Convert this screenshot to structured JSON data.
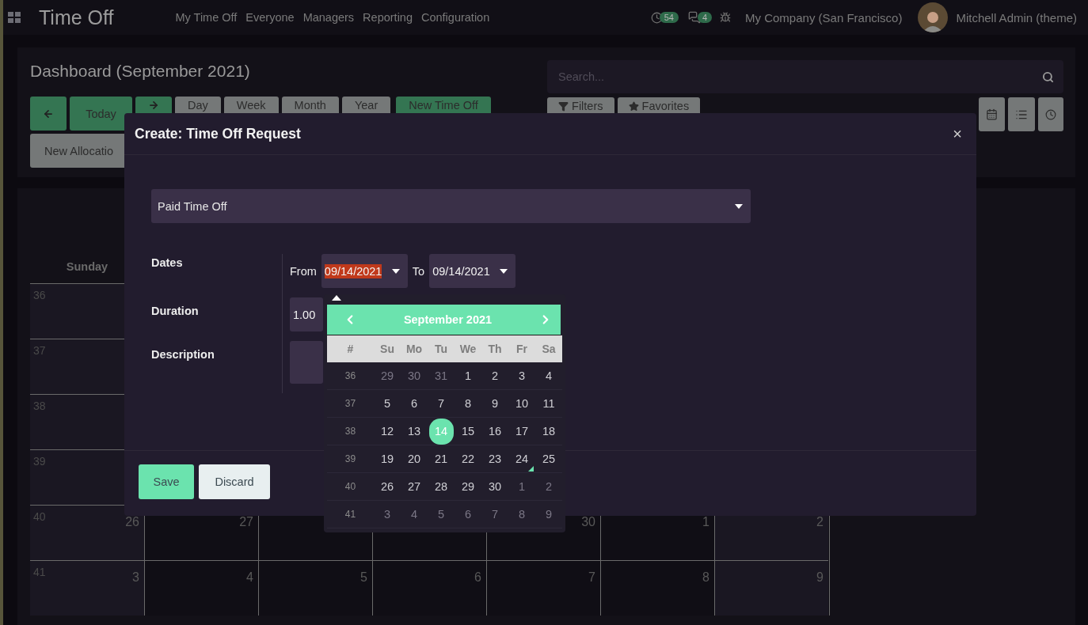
{
  "navbar": {
    "app_title": "Time Off",
    "menu": [
      "My Time Off",
      "Everyone",
      "Managers",
      "Reporting",
      "Configuration"
    ],
    "activity_count": "54",
    "message_count": "4",
    "company": "My Company (San Francisco)",
    "user": "Mitchell Admin (theme)"
  },
  "control_panel": {
    "title": "Dashboard (September 2021)",
    "today_label": "Today",
    "scales": [
      "Day",
      "Week",
      "Month",
      "Year"
    ],
    "new_button": "New Time Off",
    "allocation_button": "New Allocatio",
    "search": {
      "placeholder": "Search..."
    },
    "filters": [
      "Filters",
      "Favorites"
    ]
  },
  "calendar": {
    "columns": [
      "Sunday"
    ],
    "weeks": [
      {
        "number": "36"
      },
      {
        "number": "37"
      },
      {
        "number": "38"
      },
      {
        "number": "39"
      },
      {
        "number": "40",
        "days": {
          "sun": "26",
          "mon": "27",
          "thu": "30",
          "fri": "1",
          "sat": "2"
        }
      },
      {
        "number": "41",
        "days": {
          "sun": "3",
          "mon": "4",
          "tue": "5",
          "wed": "6",
          "thu": "7",
          "fri": "8",
          "sat": "9"
        }
      }
    ]
  },
  "dialog": {
    "title": "Create: Time Off Request",
    "close": "×",
    "leave_type": "Paid Time Off",
    "labels": [
      "Dates",
      "Duration",
      "Description"
    ],
    "from_label": "From",
    "from_date": {
      "value": "09/14/2021",
      "highlighted": true
    },
    "to_label": "To",
    "to_date": {
      "value": "09/14/2021",
      "highlighted": false
    },
    "duration": "1.00",
    "buttons": [
      {
        "label": "Save",
        "kind": "primary"
      },
      {
        "label": "Discard",
        "kind": "secondary"
      }
    ]
  },
  "datepicker": {
    "title": "September 2021",
    "week_header": "#",
    "weekdays": [
      "Su",
      "Mo",
      "Tu",
      "We",
      "Th",
      "Fr",
      "Sa"
    ],
    "weeks": [
      {
        "number": "36",
        "days": [
          {
            "label": "29",
            "muted": true,
            "selected": false,
            "today": false
          },
          {
            "label": "30",
            "muted": true,
            "selected": false,
            "today": false
          },
          {
            "label": "31",
            "muted": true,
            "selected": false,
            "today": false
          },
          {
            "label": "1",
            "muted": false,
            "selected": false,
            "today": false
          },
          {
            "label": "2",
            "muted": false,
            "selected": false,
            "today": false
          },
          {
            "label": "3",
            "muted": false,
            "selected": false,
            "today": false
          },
          {
            "label": "4",
            "muted": false,
            "selected": false,
            "today": false
          }
        ]
      },
      {
        "number": "37",
        "days": [
          {
            "label": "5",
            "muted": false,
            "selected": false,
            "today": false
          },
          {
            "label": "6",
            "muted": false,
            "selected": false,
            "today": false
          },
          {
            "label": "7",
            "muted": false,
            "selected": false,
            "today": false
          },
          {
            "label": "8",
            "muted": false,
            "selected": false,
            "today": false
          },
          {
            "label": "9",
            "muted": false,
            "selected": false,
            "today": false
          },
          {
            "label": "10",
            "muted": false,
            "selected": false,
            "today": false
          },
          {
            "label": "11",
            "muted": false,
            "selected": false,
            "today": false
          }
        ]
      },
      {
        "number": "38",
        "days": [
          {
            "label": "12",
            "muted": false,
            "selected": false,
            "today": false
          },
          {
            "label": "13",
            "muted": false,
            "selected": false,
            "today": false
          },
          {
            "label": "14",
            "muted": false,
            "selected": true,
            "today": false
          },
          {
            "label": "15",
            "muted": false,
            "selected": false,
            "today": false
          },
          {
            "label": "16",
            "muted": false,
            "selected": false,
            "today": false
          },
          {
            "label": "17",
            "muted": false,
            "selected": false,
            "today": false
          },
          {
            "label": "18",
            "muted": false,
            "selected": false,
            "today": false
          }
        ]
      },
      {
        "number": "39",
        "days": [
          {
            "label": "19",
            "muted": false,
            "selected": false,
            "today": false
          },
          {
            "label": "20",
            "muted": false,
            "selected": false,
            "today": false
          },
          {
            "label": "21",
            "muted": false,
            "selected": false,
            "today": false
          },
          {
            "label": "22",
            "muted": false,
            "selected": false,
            "today": false
          },
          {
            "label": "23",
            "muted": false,
            "selected": false,
            "today": false
          },
          {
            "label": "24",
            "muted": false,
            "selected": false,
            "today": true
          },
          {
            "label": "25",
            "muted": false,
            "selected": false,
            "today": false
          }
        ]
      },
      {
        "number": "40",
        "days": [
          {
            "label": "26",
            "muted": false,
            "selected": false,
            "today": false
          },
          {
            "label": "27",
            "muted": false,
            "selected": false,
            "today": false
          },
          {
            "label": "28",
            "muted": false,
            "selected": false,
            "today": false
          },
          {
            "label": "29",
            "muted": false,
            "selected": false,
            "today": false
          },
          {
            "label": "30",
            "muted": false,
            "selected": false,
            "today": false
          },
          {
            "label": "1",
            "muted": true,
            "selected": false,
            "today": false
          },
          {
            "label": "2",
            "muted": true,
            "selected": false,
            "today": false
          }
        ]
      },
      {
        "number": "41",
        "days": [
          {
            "label": "3",
            "muted": true,
            "selected": false,
            "today": false
          },
          {
            "label": "4",
            "muted": true,
            "selected": false,
            "today": false
          },
          {
            "label": "5",
            "muted": true,
            "selected": false,
            "today": false
          },
          {
            "label": "6",
            "muted": true,
            "selected": false,
            "today": false
          },
          {
            "label": "7",
            "muted": true,
            "selected": false,
            "today": false
          },
          {
            "label": "8",
            "muted": true,
            "selected": false,
            "today": false
          },
          {
            "label": "9",
            "muted": true,
            "selected": false,
            "today": false
          }
        ]
      }
    ]
  }
}
